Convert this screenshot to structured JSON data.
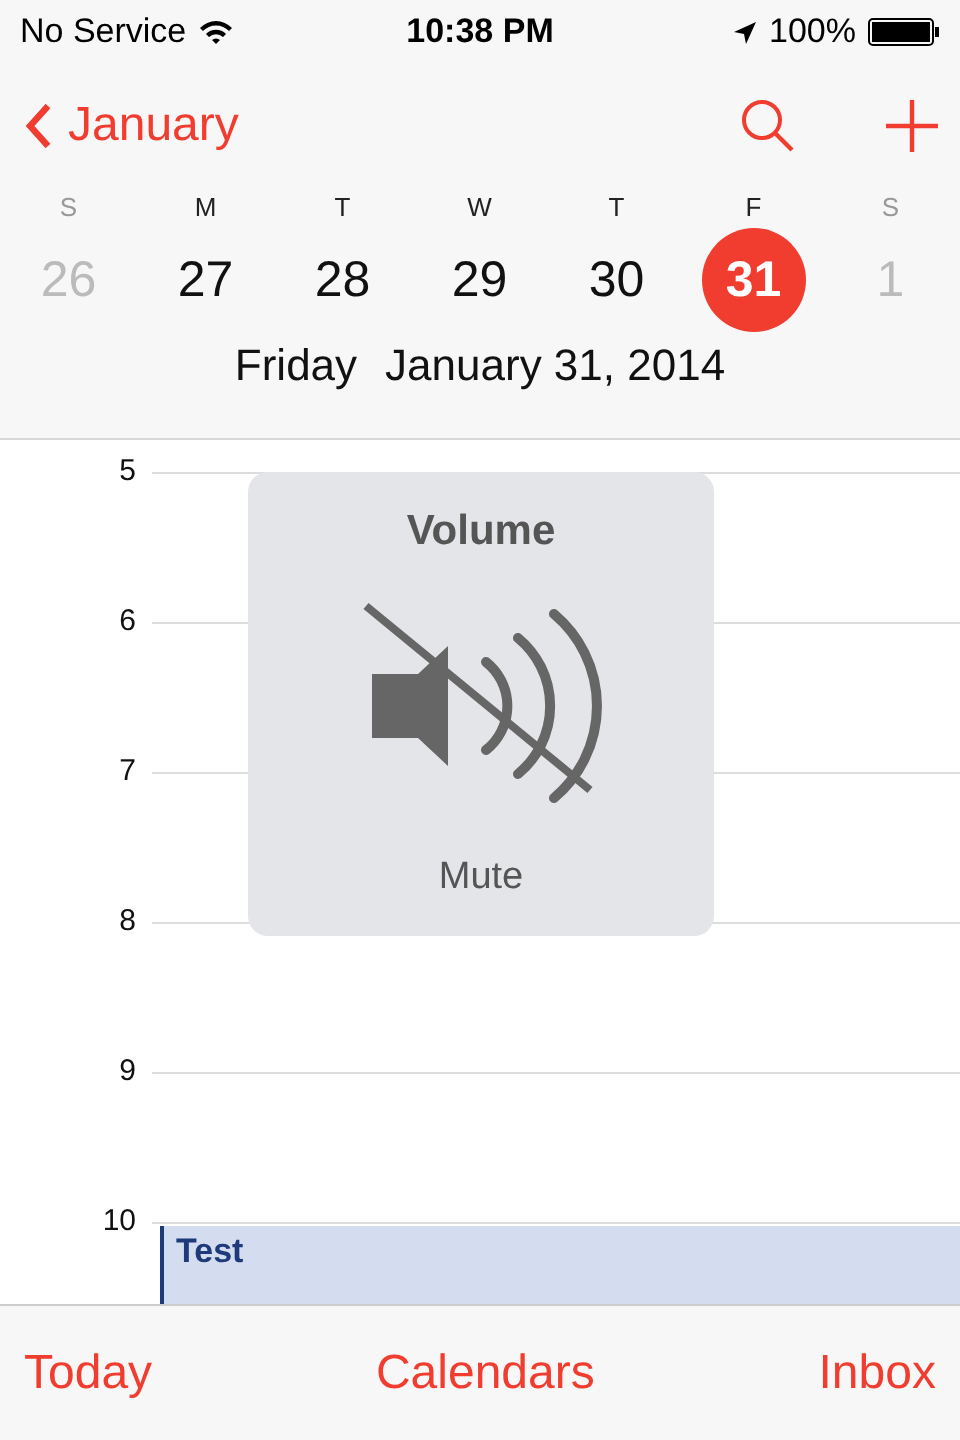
{
  "status_bar": {
    "carrier": "No Service",
    "time": "10:38 PM",
    "battery": "100%"
  },
  "nav": {
    "back": "January"
  },
  "week": [
    {
      "letter": "S",
      "date": "26",
      "in_month": false,
      "selected": false
    },
    {
      "letter": "M",
      "date": "27",
      "in_month": true,
      "selected": false
    },
    {
      "letter": "T",
      "date": "28",
      "in_month": true,
      "selected": false
    },
    {
      "letter": "W",
      "date": "29",
      "in_month": true,
      "selected": false
    },
    {
      "letter": "T",
      "date": "30",
      "in_month": true,
      "selected": false
    },
    {
      "letter": "F",
      "date": "31",
      "in_month": true,
      "selected": true
    },
    {
      "letter": "S",
      "date": "1",
      "in_month": false,
      "selected": false
    }
  ],
  "selected_day": {
    "weekday": "Friday",
    "date": "January 31, 2014"
  },
  "hours": [
    {
      "label": "5"
    },
    {
      "label": "6"
    },
    {
      "label": "7"
    },
    {
      "label": "8"
    },
    {
      "label": "9"
    },
    {
      "label": "10",
      "events": [
        {
          "title": "Test"
        }
      ]
    }
  ],
  "volume_hud": {
    "title": "Volume",
    "status": "Mute",
    "muted": true
  },
  "tab_bar": [
    "Today",
    "Calendars",
    "Inbox"
  ]
}
